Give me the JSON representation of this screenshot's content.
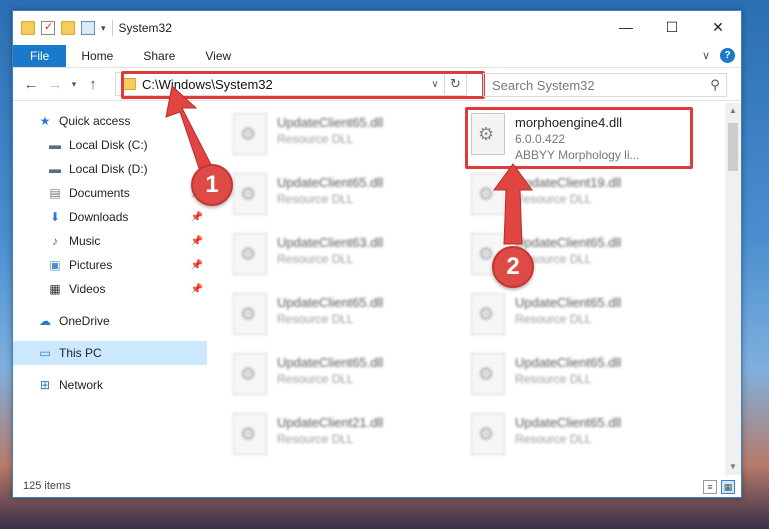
{
  "window": {
    "title": "System32",
    "controls": {
      "minimize": "—",
      "maximize": "☐",
      "close": "✕"
    }
  },
  "ribbon": {
    "tabs": [
      {
        "label": "File"
      },
      {
        "label": "Home"
      },
      {
        "label": "Share"
      },
      {
        "label": "View"
      }
    ],
    "expand_glyph": "∨",
    "help_glyph": "?"
  },
  "navigation": {
    "back_glyph": "←",
    "forward_glyph": "→",
    "recent_glyph": "▾",
    "up_glyph": "↑",
    "address": "C:\\Windows\\System32",
    "address_dropdown_glyph": "∨",
    "refresh_glyph": "↻",
    "search_placeholder": "Search System32",
    "search_glyph": "⚲"
  },
  "sidebar": {
    "items": [
      {
        "label": "Quick access",
        "icon": "star-icon",
        "glyph": "★",
        "color": "#2b78d0"
      },
      {
        "label": "Local Disk (C:)",
        "icon": "drive-icon",
        "glyph": "▬",
        "color": "#5a6d86"
      },
      {
        "label": "Local Disk (D:)",
        "icon": "drive-icon",
        "glyph": "▬",
        "color": "#5a6d86"
      },
      {
        "label": "Documents",
        "icon": "documents-icon",
        "glyph": "▤",
        "color": "#6f7c8a",
        "pin": "📌"
      },
      {
        "label": "Downloads",
        "icon": "download-icon",
        "glyph": "⬇",
        "color": "#2b78d0",
        "pin": "📌"
      },
      {
        "label": "Music",
        "icon": "music-icon",
        "glyph": "♪",
        "color": "#2b78d0",
        "pin": "📌"
      },
      {
        "label": "Pictures",
        "icon": "pictures-icon",
        "glyph": "▣",
        "color": "#4b8fc9",
        "pin": "📌"
      },
      {
        "label": "Videos",
        "icon": "videos-icon",
        "glyph": "▦",
        "color": "#333",
        "pin": "📌"
      },
      {
        "label": "OneDrive",
        "icon": "cloud-icon",
        "glyph": "☁",
        "color": "#2b78d0"
      },
      {
        "label": "This PC",
        "icon": "computer-icon",
        "glyph": "▭",
        "color": "#2b78d0"
      },
      {
        "label": "Network",
        "icon": "network-icon",
        "glyph": "⊞",
        "color": "#2b78d0"
      }
    ]
  },
  "files": {
    "highlighted": {
      "name": "morphoengine4.dll",
      "version": "6.0.0.422",
      "description": "ABBYY Morphology li..."
    },
    "left_column": [
      {
        "name": "UpdateClient65.dll",
        "type": "Resource DLL"
      },
      {
        "name": "UpdateClient65.dll",
        "type": "Resource DLL"
      },
      {
        "name": "UpdateClient63.dll",
        "type": "Resource DLL"
      },
      {
        "name": "UpdateClient65.dll",
        "type": "Resource DLL"
      },
      {
        "name": "UpdateClient65.dll",
        "type": "Resource DLL"
      },
      {
        "name": "UpdateClient21.dll",
        "type": "Resource DLL"
      }
    ],
    "right_column": [
      {
        "name": "UpdateClient19.dll",
        "type": "Resource DLL"
      },
      {
        "name": "UpdateClient65.dll",
        "type": "Resource DLL"
      },
      {
        "name": "UpdateClient65.dll",
        "type": "Resource DLL"
      },
      {
        "name": "UpdateClient65.dll",
        "type": "Resource DLL"
      },
      {
        "name": "UpdateClient65.dll",
        "type": "Resource DLL"
      }
    ]
  },
  "annotations": {
    "step1": "1",
    "step2": "2",
    "color": "#e03a3a"
  },
  "status": {
    "items_count": "125 items"
  }
}
